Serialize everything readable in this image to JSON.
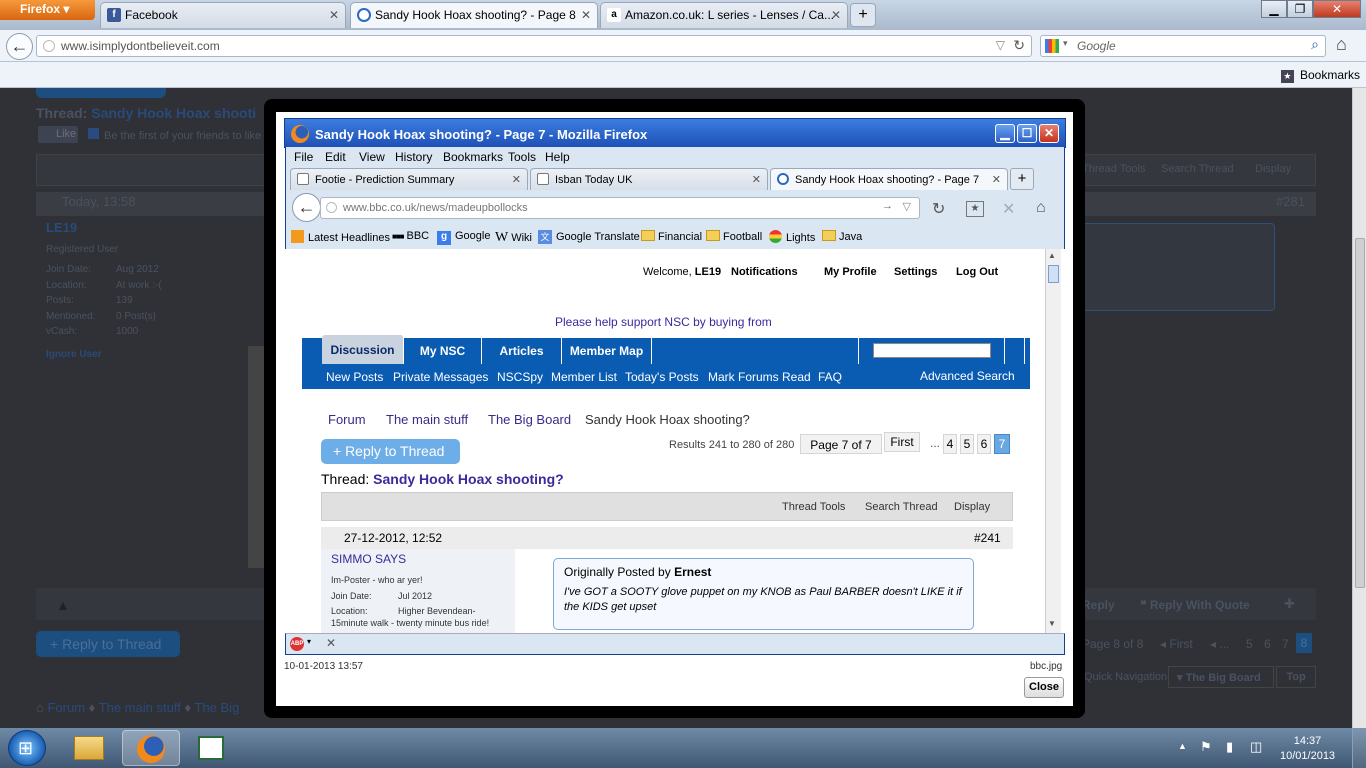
{
  "outer_browser": {
    "menu_button": "Firefox",
    "tabs": [
      {
        "label": "Facebook",
        "icon": "facebook-icon",
        "active": false
      },
      {
        "label": "Sandy Hook Hoax shooting? - Page 8",
        "icon": "nsc-icon",
        "active": true
      },
      {
        "label": "Amazon.co.uk: L series - Lenses / Ca...",
        "icon": "amazon-icon",
        "active": false
      }
    ],
    "new_tab": "+",
    "url": "www.isimplydontbelieveit.com",
    "search_placeholder": "Google",
    "bookmarks_label": "Bookmarks"
  },
  "background_page": {
    "thread_title_prefix": "Thread:",
    "thread_title": "Sandy Hook Hoax shooti",
    "like_label": "Like",
    "like_text": "Be the first of your friends to like",
    "toolbar": [
      "Thread Tools",
      "Search Thread",
      "Display"
    ],
    "post_date": "Today, 13:58",
    "post_number": "#281",
    "username": "LE19",
    "user_title": "Registered User",
    "user_fields": [
      {
        "label": "Join Date:",
        "value": "Aug 2012"
      },
      {
        "label": "Location:",
        "value": "At work :-("
      },
      {
        "label": "Posts:",
        "value": "139"
      },
      {
        "label": "Mentioned:",
        "value": "0 Post(s)"
      },
      {
        "label": "vCash:",
        "value": "1000"
      }
    ],
    "ignore_user": "Ignore User",
    "reply_label": "Reply",
    "reply_with_quote": "Reply With Quote",
    "reply_to_thread": "+ Reply to Thread",
    "page_info": "Page 8 of 8",
    "pager_first": "First",
    "pager_pages": [
      "5",
      "6",
      "7",
      "8"
    ],
    "quick_navigation": "Quick Navigation",
    "quick_nav_select": "The Big Board",
    "top_label": "Top",
    "breadcrumbs": [
      "Forum",
      "The main stuff",
      "The Big"
    ]
  },
  "lightbox": {
    "window_title": "Sandy Hook Hoax shooting? - Page 7 - Mozilla Firefox",
    "menu": [
      "File",
      "Edit",
      "View",
      "History",
      "Bookmarks",
      "Tools",
      "Help"
    ],
    "tabs": [
      {
        "label": "Footie - Prediction Summary",
        "active": false
      },
      {
        "label": "Isban Today UK",
        "active": false
      },
      {
        "label": "Sandy Hook Hoax shooting? - Page 7",
        "active": true
      }
    ],
    "url_domain": "www.bbc.co.uk",
    "url_path": "/news/madeupbollocks",
    "bookmarks": [
      "Latest Headlines",
      "BBC",
      "Google",
      "Wiki",
      "Google Translate",
      "Financial",
      "Football",
      "Lights",
      "Java"
    ],
    "page": {
      "welcome": "Welcome,",
      "username": "LE19",
      "top_links": [
        "Notifications",
        "My Profile",
        "Settings",
        "Log Out"
      ],
      "support_text": "Please help support NSC by buying from",
      "nav_tabs": [
        "Discussion",
        "My NSC",
        "Articles",
        "Member Map"
      ],
      "sub_links": [
        "New Posts",
        "Private Messages",
        "NSCSpy",
        "Member List",
        "Today's Posts",
        "Mark Forums Read",
        "FAQ"
      ],
      "advanced_search": "Advanced Search",
      "breadcrumbs": [
        "Forum",
        "The main stuff",
        "The Big Board",
        "Sandy Hook Hoax shooting?"
      ],
      "reply_to_thread": "+ Reply to Thread",
      "results": "Results 241 to 280 of 280",
      "page_info": "Page 7 of 7",
      "pager_first": "First",
      "pager_ellipsis": "...",
      "pager_pages": [
        "4",
        "5",
        "6",
        "7"
      ],
      "thread_prefix": "Thread:",
      "thread_title": "Sandy Hook Hoax shooting?",
      "toolbar": [
        "Thread Tools",
        "Search Thread",
        "Display"
      ],
      "post_date": "27-12-2012, 12:52",
      "post_number": "#241",
      "post_username": "SIMMO SAYS",
      "post_user_title": "Im-Poster - who ar yer!",
      "post_user_fields": [
        {
          "label": "Join Date:",
          "value": "Jul 2012"
        },
        {
          "label": "Location:",
          "value": "Higher Bevendean-"
        }
      ],
      "post_user_location_2": "15minute walk - twenty minute bus ride!",
      "quote_prefix": "Originally Posted by",
      "quote_author": "Ernest",
      "quote_text": "I've GOT a SOOTY glove puppet on my KNOB as Paul BARBER doesn't LIKE it if the KIDS get upset"
    },
    "caption": "10-01-2013 13:57",
    "filename": "bbc.jpg",
    "close_label": "Close"
  },
  "taskbar": {
    "time": "14:37",
    "date": "10/01/2013"
  }
}
